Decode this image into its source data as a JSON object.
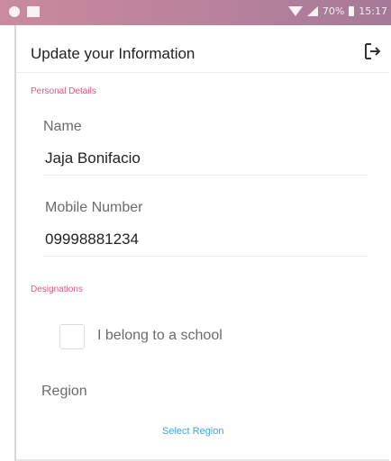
{
  "status_bar": {
    "battery_text": "70%",
    "time": "15:17"
  },
  "header": {
    "title": "Update your Information"
  },
  "personal_details": {
    "section_label": "Personal Details",
    "name": {
      "label": "Name",
      "value": "Jaja Bonifacio"
    },
    "mobile": {
      "label": "Mobile Number",
      "value": "09998881234"
    }
  },
  "designations": {
    "section_label": "Designations",
    "school_checkbox": {
      "label": "I belong to a school",
      "checked": false
    },
    "region": {
      "label": "Region",
      "select_label": "Select Region"
    }
  },
  "colors": {
    "status_bar": "#b9829c",
    "section_label": "#e8537f",
    "link": "#3ba6d8",
    "text_primary": "#222222",
    "text_secondary": "#6b6b6b"
  },
  "icons": {
    "logout": "logout-icon",
    "wifi": "wifi-icon",
    "signal": "signal-icon",
    "battery": "battery-icon"
  }
}
